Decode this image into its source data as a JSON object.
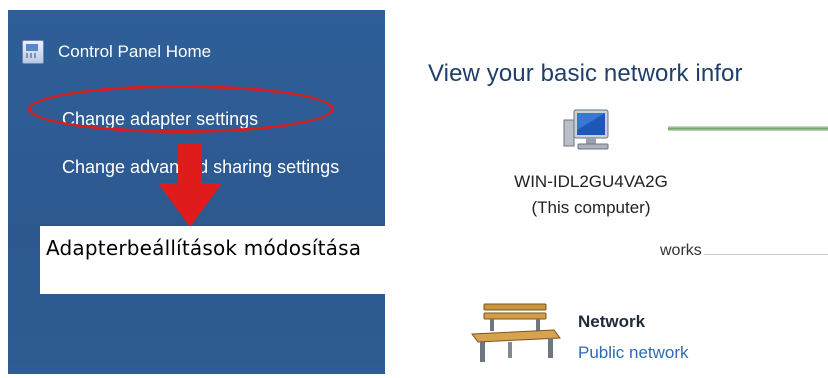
{
  "sidebar": {
    "control_panel_home": "Control Panel Home",
    "change_adapter": "Change adapter settings",
    "change_sharing": "Change advanced sharing settings"
  },
  "annotation": {
    "callout_text": "Adapterbeállítások módosítása",
    "highlight_color": "#d91d1d"
  },
  "main": {
    "title": "View your basic network infor",
    "computer_name": "WIN-IDL2GU4VA2G",
    "computer_sub": "(This computer)",
    "networks_label": "works",
    "network_name": "Network",
    "network_type": "Public network"
  },
  "icons": {
    "control_panel": "control-panel-icon",
    "computer": "computer-icon",
    "network": "bench-icon",
    "arrow": "arrow-down-icon"
  }
}
